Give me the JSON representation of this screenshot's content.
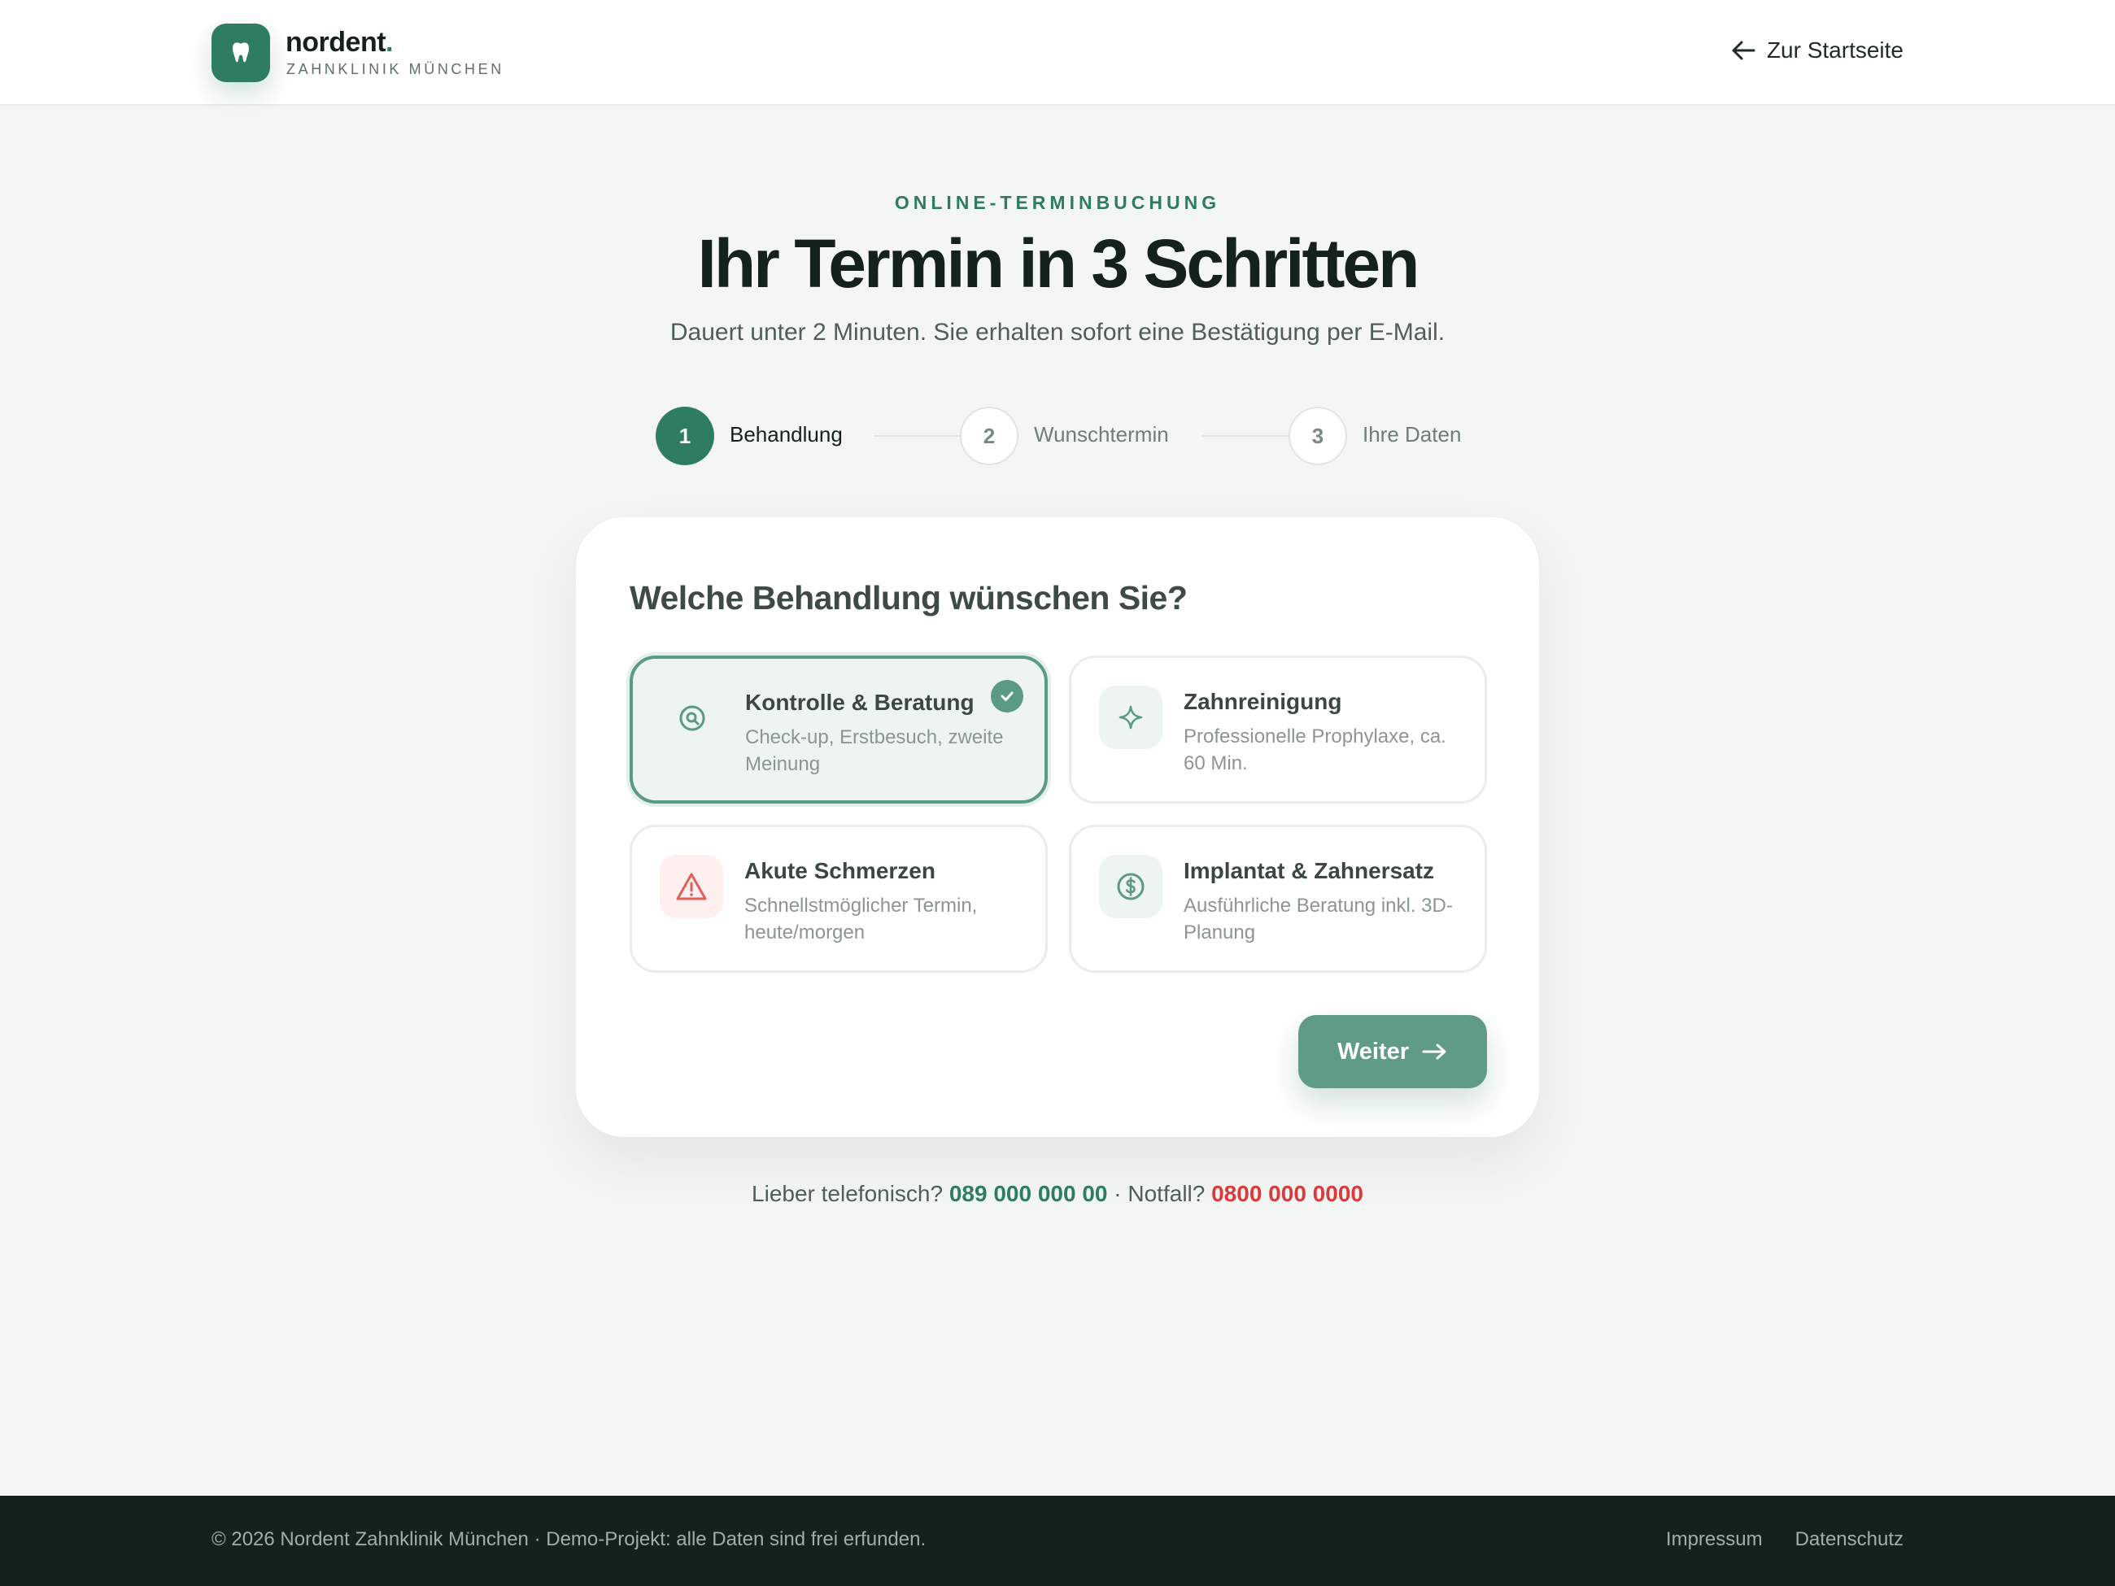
{
  "header": {
    "brand_name": "nordent",
    "brand_dot": ".",
    "brand_subtitle": "ZAHNKLINIK MÜNCHEN",
    "back_link": "Zur Startseite"
  },
  "hero": {
    "eyebrow": "ONLINE-TERMINBUCHUNG",
    "title": "Ihr Termin in 3 Schritten",
    "subtitle": "Dauert unter 2 Minuten. Sie erhalten sofort eine Bestätigung per E-Mail."
  },
  "steps": [
    {
      "number": "1",
      "label": "Behandlung",
      "state": "active"
    },
    {
      "number": "2",
      "label": "Wunschtermin",
      "state": "idle"
    },
    {
      "number": "3",
      "label": "Ihre Daten",
      "state": "idle"
    }
  ],
  "card": {
    "question": "Welche Behandlung wünschen Sie?",
    "options": [
      {
        "title": "Kontrolle & Beratung",
        "description": "Check-up, Erstbesuch, zweite Meinung",
        "icon": "search-icon",
        "selected": true
      },
      {
        "title": "Zahnreinigung",
        "description": "Professionelle Prophylaxe, ca. 60 Min.",
        "icon": "sparkle-icon",
        "selected": false
      },
      {
        "title": "Akute Schmerzen",
        "description": "Schnellstmöglicher Termin, heute/morgen",
        "icon": "warning-icon",
        "selected": false
      },
      {
        "title": "Implantat & Zahnersatz",
        "description": "Ausführliche Beratung inkl. 3D-Planung",
        "icon": "dollar-icon",
        "selected": false
      }
    ],
    "next_label": "Weiter"
  },
  "contact": {
    "phone_prefix": "Lieber telefonisch?",
    "phone": "089 000 000 00",
    "separator": "·",
    "emergency_prefix": "Notfall?",
    "emergency_phone": "0800 000 0000"
  },
  "footer": {
    "copyright": "© 2026 Nordent Zahnklinik München · Demo-Projekt: alle Daten sind frei erfunden.",
    "links": [
      "Impressum",
      "Datenschutz"
    ]
  },
  "colors": {
    "brand": "#2e7d63",
    "button": "#5f9b85",
    "emergency": "#d93b3b",
    "footer_bg": "#14211c",
    "page_bg": "#f4f6f5"
  }
}
